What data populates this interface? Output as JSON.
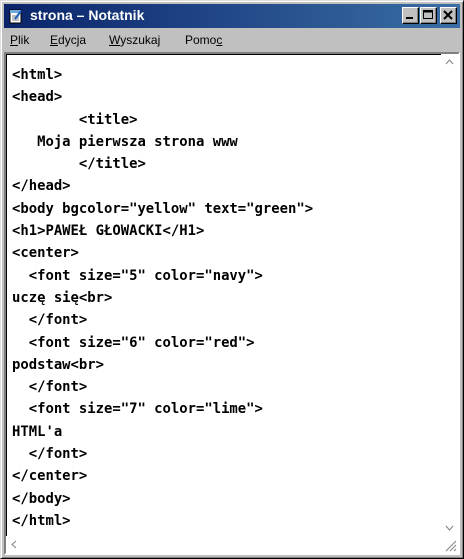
{
  "window": {
    "title": "strona – Notatnik",
    "icon": "notepad-icon"
  },
  "titlebar_buttons": {
    "minimize_icon": "minimize-icon",
    "maximize_icon": "maximize-icon",
    "close_icon": "close-icon"
  },
  "menu": {
    "items": [
      {
        "label": "Plik",
        "mnemonic": "P"
      },
      {
        "label": "Edycja",
        "mnemonic": "E"
      },
      {
        "label": "Wyszukaj",
        "mnemonic": "W"
      },
      {
        "label": "Pomoc",
        "mnemonic": "c"
      }
    ]
  },
  "editor": {
    "lines": [
      "<html>",
      "<head>",
      "        <title>",
      "   Moja pierwsza strona www",
      "        </title>",
      "</head>",
      "<body bgcolor=\"yellow\" text=\"green\">",
      "<h1>PAWEŁ GŁOWACKI</H1>",
      "<center>",
      "  <font size=\"5\" color=\"navy\">",
      "uczę się<br>",
      "  </font>",
      "  <font size=\"6\" color=\"red\">",
      "podstaw<br>",
      "  </font>",
      "  <font size=\"7\" color=\"lime\">",
      "HTML'a",
      "  </font>",
      "</center>",
      "</body>",
      "</html>"
    ]
  },
  "colors": {
    "titlebar_start": "#0a246a",
    "titlebar_end": "#3a6ea5",
    "window_face": "#c0c0c0",
    "editor_bg": "#ffffff"
  }
}
